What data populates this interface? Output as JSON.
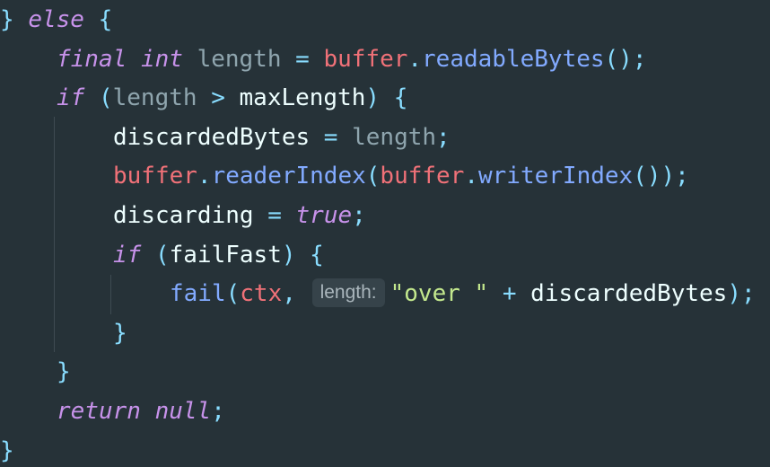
{
  "editor": {
    "theme_colors": {
      "background": "#263238",
      "keyword": "#C792EA",
      "identifier": "#EEFFFF",
      "variable": "#B2CCD6",
      "object": "#F07178",
      "method": "#82AAFF",
      "operator": "#89DDFF",
      "string": "#C3E88D",
      "hint_background": "#36434A"
    },
    "lines": [
      {
        "indent": 0,
        "tokens": [
          {
            "t": "} ",
            "c": "pun"
          },
          {
            "t": "else",
            "c": "kw"
          },
          {
            "t": " {",
            "c": "pun"
          }
        ]
      },
      {
        "indent": 1,
        "tokens": [
          {
            "t": "final",
            "c": "kw"
          },
          {
            "t": " ",
            "c": "id"
          },
          {
            "t": "int",
            "c": "kw"
          },
          {
            "t": " ",
            "c": "id"
          },
          {
            "t": "length",
            "c": "var"
          },
          {
            "t": " = ",
            "c": "op"
          },
          {
            "t": "buffer",
            "c": "obj"
          },
          {
            "t": ".",
            "c": "pun"
          },
          {
            "t": "readableBytes",
            "c": "fn"
          },
          {
            "t": "();",
            "c": "pun"
          }
        ]
      },
      {
        "indent": 1,
        "tokens": [
          {
            "t": "if",
            "c": "kw"
          },
          {
            "t": " (",
            "c": "pun"
          },
          {
            "t": "length",
            "c": "var"
          },
          {
            "t": " > ",
            "c": "op"
          },
          {
            "t": "maxLength",
            "c": "id"
          },
          {
            "t": ") {",
            "c": "pun"
          }
        ]
      },
      {
        "indent": 2,
        "tokens": [
          {
            "t": "discardedBytes",
            "c": "id"
          },
          {
            "t": " = ",
            "c": "op"
          },
          {
            "t": "length",
            "c": "var"
          },
          {
            "t": ";",
            "c": "pun"
          }
        ]
      },
      {
        "indent": 2,
        "tokens": [
          {
            "t": "buffer",
            "c": "obj"
          },
          {
            "t": ".",
            "c": "pun"
          },
          {
            "t": "readerIndex",
            "c": "fn"
          },
          {
            "t": "(",
            "c": "pun"
          },
          {
            "t": "buffer",
            "c": "obj"
          },
          {
            "t": ".",
            "c": "pun"
          },
          {
            "t": "writerIndex",
            "c": "fn"
          },
          {
            "t": "());",
            "c": "pun"
          }
        ]
      },
      {
        "indent": 2,
        "tokens": [
          {
            "t": "discarding",
            "c": "id"
          },
          {
            "t": " = ",
            "c": "op"
          },
          {
            "t": "true",
            "c": "kw"
          },
          {
            "t": ";",
            "c": "pun"
          }
        ]
      },
      {
        "indent": 2,
        "tokens": [
          {
            "t": "if",
            "c": "kw"
          },
          {
            "t": " (",
            "c": "pun"
          },
          {
            "t": "failFast",
            "c": "id"
          },
          {
            "t": ") {",
            "c": "pun"
          }
        ]
      },
      {
        "indent": 3,
        "tokens": [
          {
            "t": "fail",
            "c": "fn"
          },
          {
            "t": "(",
            "c": "pun"
          },
          {
            "t": "ctx",
            "c": "obj"
          },
          {
            "t": ",",
            "c": "pun"
          },
          {
            "t": " ",
            "c": "id"
          },
          {
            "t": "length:",
            "c": "hint"
          },
          {
            "t": "\"over \"",
            "c": "str"
          },
          {
            "t": " + ",
            "c": "op"
          },
          {
            "t": "discardedBytes",
            "c": "id"
          },
          {
            "t": ");",
            "c": "pun"
          }
        ]
      },
      {
        "indent": 2,
        "tokens": [
          {
            "t": "}",
            "c": "pun"
          }
        ]
      },
      {
        "indent": 1,
        "tokens": [
          {
            "t": "}",
            "c": "pun"
          }
        ]
      },
      {
        "indent": 1,
        "tokens": [
          {
            "t": "return",
            "c": "kw"
          },
          {
            "t": " ",
            "c": "id"
          },
          {
            "t": "null",
            "c": "kw"
          },
          {
            "t": ";",
            "c": "pun"
          }
        ]
      },
      {
        "indent": 0,
        "tokens": [
          {
            "t": "}",
            "c": "pun"
          }
        ]
      }
    ]
  }
}
